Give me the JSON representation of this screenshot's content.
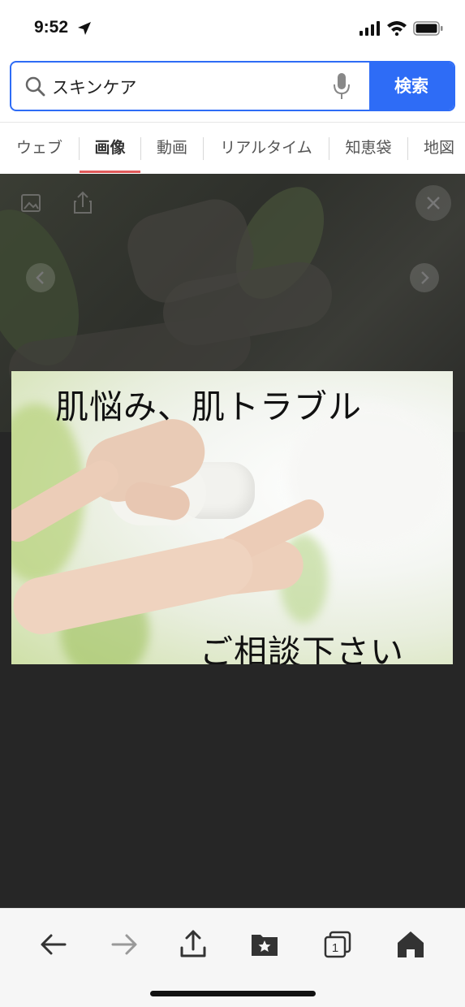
{
  "status_bar": {
    "time": "9:52",
    "location_icon": "location-arrow-icon",
    "signal_icon": "cellular-signal-icon",
    "wifi_icon": "wifi-icon",
    "battery_icon": "battery-icon"
  },
  "search": {
    "value": "スキンケア",
    "button_label": "検索",
    "search_icon": "search-icon",
    "mic_icon": "microphone-icon",
    "accent_color": "#2e6cf6"
  },
  "tabs": [
    {
      "label": "ウェブ",
      "active": false
    },
    {
      "label": "画像",
      "active": true
    },
    {
      "label": "動画",
      "active": false
    },
    {
      "label": "リアルタイム",
      "active": false
    },
    {
      "label": "知恵袋",
      "active": false
    },
    {
      "label": "地図",
      "active": false
    }
  ],
  "viewer": {
    "save_icon": "save-image-icon",
    "share_icon": "share-icon",
    "close_icon": "close-icon",
    "prev_icon": "chevron-left-icon",
    "next_icon": "chevron-right-icon",
    "background_color": "#262626"
  },
  "main_image": {
    "text_top": "肌悩み、肌トラブル",
    "text_bottom": "ご相談下さい"
  },
  "toolbar": {
    "back_icon": "back-arrow-icon",
    "forward_icon": "forward-arrow-icon",
    "share_icon": "share-icon",
    "bookmark_icon": "bookmark-folder-icon",
    "tabs_icon": "tabs-icon",
    "tabs_count": "1",
    "home_icon": "home-icon"
  }
}
